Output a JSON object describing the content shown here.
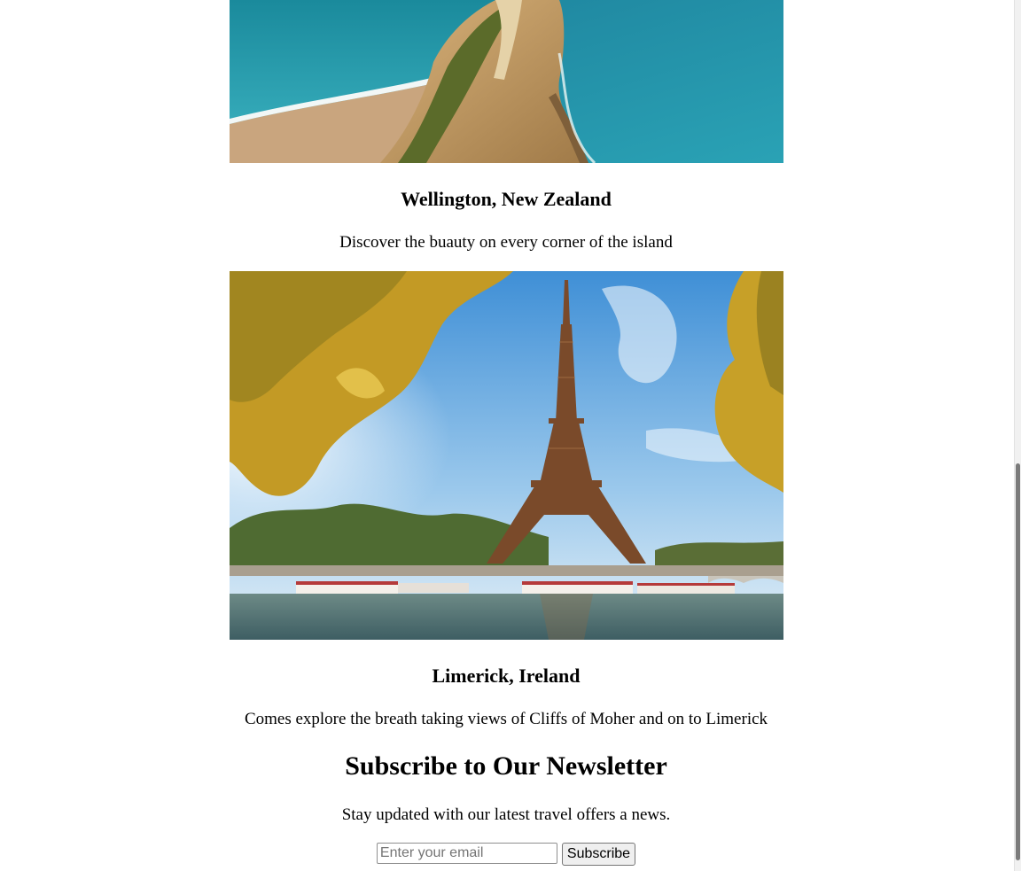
{
  "destinations": [
    {
      "title": "Wellington, New Zealand",
      "description": "Discover the buauty on every corner of the island"
    },
    {
      "title": "Limerick, Ireland",
      "description": "Comes explore the breath taking views of Cliffs of Moher and on to Limerick"
    }
  ],
  "newsletter": {
    "title": "Subscribe to Our Newsletter",
    "text": "Stay updated with our latest travel offers a news.",
    "email_placeholder": "Enter your email",
    "button_label": "Subscribe"
  },
  "colors": {
    "sea": "#1f8fa6",
    "sky": "#4a9fde",
    "foliage": "#c9a42a",
    "tower": "#7a4a2a"
  }
}
